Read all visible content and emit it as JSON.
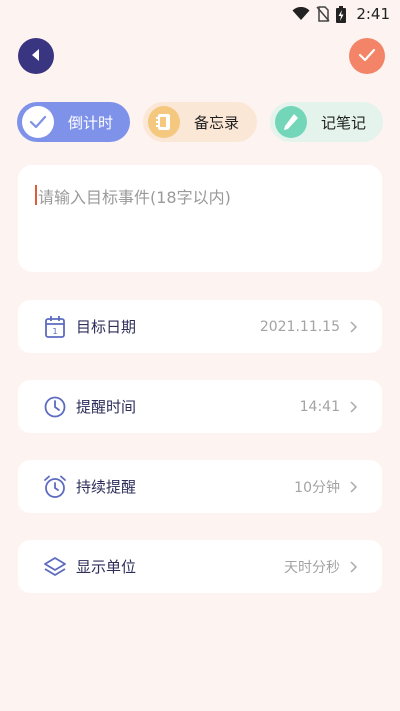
{
  "status_bar": {
    "time": "2:41",
    "icons": [
      "wifi-icon",
      "no-sim-icon",
      "battery-charging-icon"
    ]
  },
  "header": {
    "back_icon": "back-arrow-icon",
    "confirm_icon": "checkmark-icon"
  },
  "tabs": [
    {
      "label": "倒计时",
      "icon": "check-icon",
      "active": true
    },
    {
      "label": "备忘录",
      "icon": "notebook-icon",
      "active": false
    },
    {
      "label": "记笔记",
      "icon": "pen-icon",
      "active": false
    }
  ],
  "event_input": {
    "placeholder": "请输入目标事件(18字以内)",
    "value": ""
  },
  "settings": [
    {
      "label": "目标日期",
      "value": "2021.11.15",
      "icon": "calendar-icon"
    },
    {
      "label": "提醒时间",
      "value": "14:41",
      "icon": "clock-icon"
    },
    {
      "label": "持续提醒",
      "value": "10分钟",
      "icon": "alarm-clock-icon"
    },
    {
      "label": "显示单位",
      "value": "天时分秒",
      "icon": "layers-icon"
    }
  ],
  "colors": {
    "background": "#fdf3f0",
    "back_button": "#3a3580",
    "confirm_button": "#f38467",
    "tab_active": "#7f92ea",
    "icon_stroke": "#5c6bc0"
  }
}
